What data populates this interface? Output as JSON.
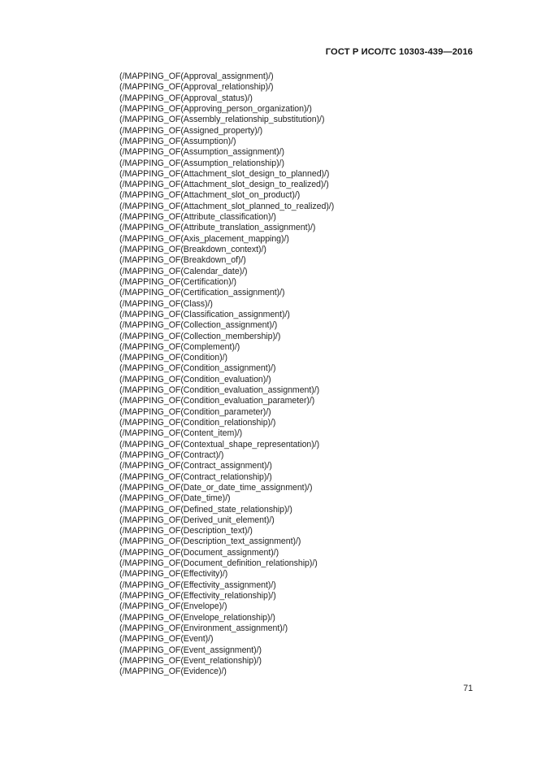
{
  "document": {
    "standard_header": "ГОСТ Р ИСО/ТС 10303-439—2016",
    "page_number": "71"
  },
  "body": {
    "lines": [
      "(/MAPPING_OF(Approval_assignment)/)",
      "(/MAPPING_OF(Approval_relationship)/)",
      "(/MAPPING_OF(Approval_status)/)",
      "(/MAPPING_OF(Approving_person_organization)/)",
      "(/MAPPING_OF(Assembly_relationship_substitution)/)",
      "(/MAPPING_OF(Assigned_property)/)",
      "(/MAPPING_OF(Assumption)/)",
      "(/MAPPING_OF(Assumption_assignment)/)",
      "(/MAPPING_OF(Assumption_relationship)/)",
      "(/MAPPING_OF(Attachment_slot_design_to_planned)/)",
      "(/MAPPING_OF(Attachment_slot_design_to_realized)/)",
      "(/MAPPING_OF(Attachment_slot_on_product)/)",
      "(/MAPPING_OF(Attachment_slot_planned_to_realized)/)",
      "(/MAPPING_OF(Attribute_classification)/)",
      "(/MAPPING_OF(Attribute_translation_assignment)/)",
      "(/MAPPING_OF(Axis_placement_mapping)/)",
      "(/MAPPING_OF(Breakdown_context)/)",
      "(/MAPPING_OF(Breakdown_of)/)",
      "(/MAPPING_OF(Calendar_date)/)",
      "(/MAPPING_OF(Certification)/)",
      "(/MAPPING_OF(Certification_assignment)/)",
      "(/MAPPING_OF(Class)/)",
      "(/MAPPING_OF(Classification_assignment)/)",
      "(/MAPPING_OF(Collection_assignment)/)",
      "(/MAPPING_OF(Collection_membership)/)",
      "(/MAPPING_OF(Complement)/)",
      "(/MAPPING_OF(Condition)/)",
      "(/MAPPING_OF(Condition_assignment)/)",
      "(/MAPPING_OF(Condition_evaluation)/)",
      "(/MAPPING_OF(Condition_evaluation_assignment)/)",
      "(/MAPPING_OF(Condition_evaluation_parameter)/)",
      "(/MAPPING_OF(Condition_parameter)/)",
      "(/MAPPING_OF(Condition_relationship)/)",
      "(/MAPPING_OF(Content_item)/)",
      "(/MAPPING_OF(Contextual_shape_representation)/)",
      "(/MAPPING_OF(Contract)/)",
      "(/MAPPING_OF(Contract_assignment)/)",
      "(/MAPPING_OF(Contract_relationship)/)",
      "(/MAPPING_OF(Date_or_date_time_assignment)/)",
      "(/MAPPING_OF(Date_time)/)",
      "(/MAPPING_OF(Defined_state_relationship)/)",
      "(/MAPPING_OF(Derived_unit_element)/)",
      "(/MAPPING_OF(Description_text)/)",
      "(/MAPPING_OF(Description_text_assignment)/)",
      "(/MAPPING_OF(Document_assignment)/)",
      "(/MAPPING_OF(Document_definition_relationship)/)",
      "(/MAPPING_OF(Effectivity)/)",
      "(/MAPPING_OF(Effectivity_assignment)/)",
      "(/MAPPING_OF(Effectivity_relationship)/)",
      "(/MAPPING_OF(Envelope)/)",
      "(/MAPPING_OF(Envelope_relationship)/)",
      "(/MAPPING_OF(Environment_assignment)/)",
      "(/MAPPING_OF(Event)/)",
      "(/MAPPING_OF(Event_assignment)/)",
      "(/MAPPING_OF(Event_relationship)/)",
      "(/MAPPING_OF(Evidence)/)"
    ]
  }
}
